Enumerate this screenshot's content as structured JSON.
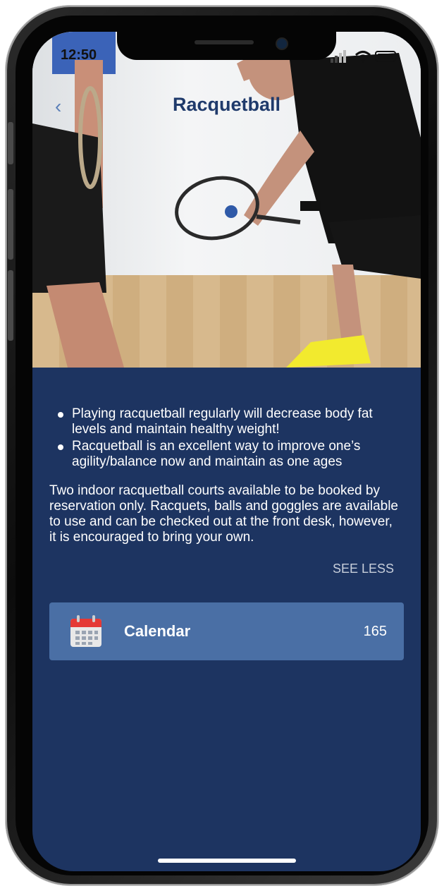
{
  "status_bar": {
    "time": "12:50"
  },
  "header": {
    "title": "Racquetball",
    "back_icon": "chevron-left-icon"
  },
  "hero": {
    "image_subject": "racquetball-players-photo"
  },
  "content": {
    "bullets": [
      "Playing racquetball regularly will decrease body fat levels and maintain healthy weight!",
      "Racquetball is an excellent way to improve one’s agility/balance now and maintain as one ages"
    ],
    "description": "Two indoor racquetball courts available to be booked by reservation only. Racquets, balls and goggles are available to use and can be checked out at the front desk, however, it is encouraged to bring your own.",
    "see_less_label": "SEE LESS"
  },
  "calendar_item": {
    "icon": "calendar-icon",
    "label": "Calendar",
    "count": "165"
  },
  "colors": {
    "background": "#1d3461",
    "calendar_row": "#4a6fa5",
    "title": "#1f3a6b",
    "calendar_icon_top": "#e53935"
  }
}
